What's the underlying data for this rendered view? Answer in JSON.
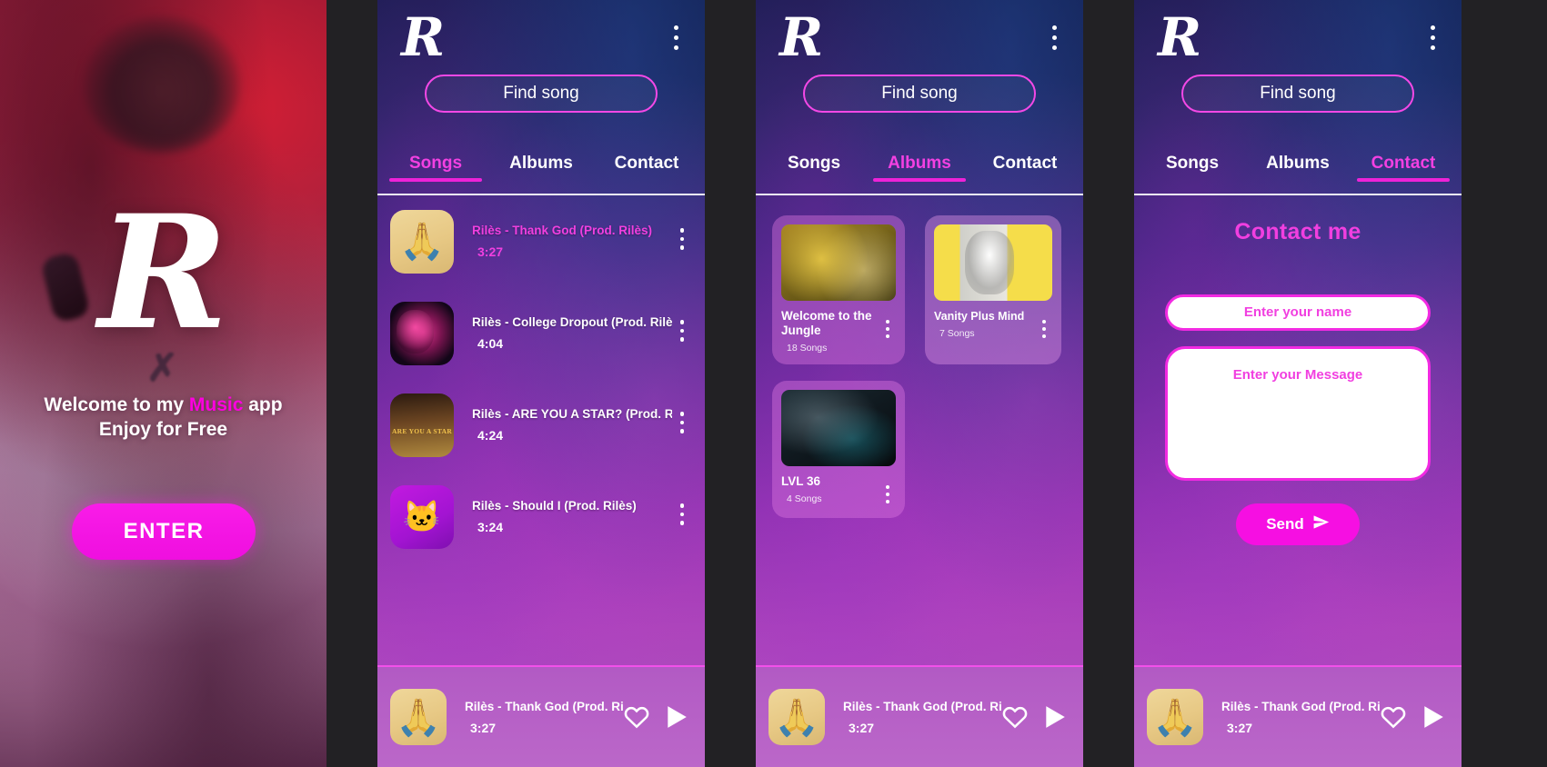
{
  "splash": {
    "logo": "R",
    "welcome_prefix": "Welcome to my ",
    "welcome_highlight": "Music",
    "welcome_suffix": " app",
    "welcome_line2": "Enjoy for Free",
    "enter_label": "ENTER",
    "accent": "#ff00e0"
  },
  "shared": {
    "logo": "R",
    "search_placeholder": "Find song",
    "menu_icon": "kebab-menu-icon",
    "accent_pink": "#f13fe0",
    "tabs": [
      {
        "label": "Songs"
      },
      {
        "label": "Albums"
      },
      {
        "label": "Contact"
      }
    ]
  },
  "panels": {
    "songs": {
      "active_tab": "Songs",
      "items": [
        {
          "title": "Rilès - Thank God (Prod. Rilès)",
          "duration": "3:27",
          "playing": true
        },
        {
          "title": "Rilès - College Dropout (Prod. Rilès)",
          "duration": "4:04",
          "playing": false
        },
        {
          "title": "Rilès - ARE YOU A STAR? (Prod. Rilès)",
          "duration": "4:24",
          "playing": false
        },
        {
          "title": "Rilès -  Should I (Prod. Rilès)",
          "duration": "3:24",
          "playing": false
        }
      ]
    },
    "albums": {
      "active_tab": "Albums",
      "items": [
        {
          "name": "Welcome to the Jungle",
          "count": "18 Songs"
        },
        {
          "name": "Vanity Plus Mind",
          "count": "7 Songs"
        },
        {
          "name": "LVL 36",
          "count": "4 Songs"
        }
      ]
    },
    "contact": {
      "active_tab": "Contact",
      "title": "Contact me",
      "name_placeholder": "Enter your name",
      "name_value": "",
      "message_placeholder": "Enter your Message",
      "message_value": "",
      "send_label": "Send",
      "send_icon": "paper-plane-icon"
    }
  },
  "player": {
    "title": "Rilès - Thank God (Prod. Rilès)",
    "duration": "3:27",
    "like_icon": "heart-icon",
    "play_icon": "play-icon"
  }
}
